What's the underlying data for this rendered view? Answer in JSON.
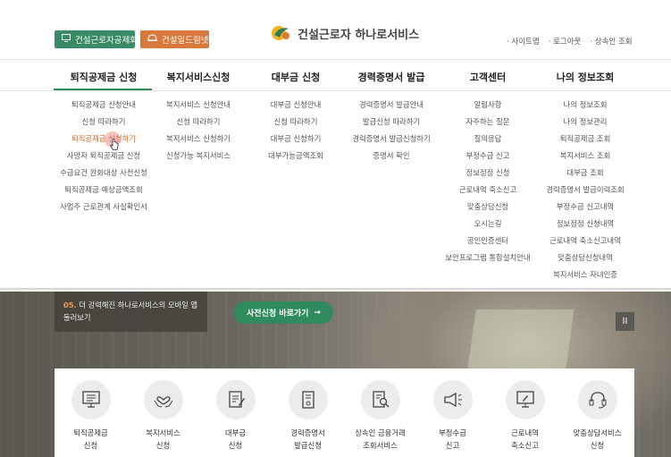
{
  "header": {
    "btn_mutual_aid": "건설근로자공제회",
    "btn_dream": "건설일드림넷",
    "logo_text": "건설근로자 하나로서비스",
    "util_links": [
      "사이트맵",
      "로그아웃",
      "상속인 조회"
    ]
  },
  "nav": {
    "tabs": [
      "퇴직공제금 신청",
      "복지서비스신청",
      "대부금 신청",
      "경력증명서 발급",
      "고객센터",
      "나의 정보조회"
    ],
    "active_index": 0
  },
  "dropdown": {
    "columns": [
      [
        "퇴직공제금 신청안내",
        "신청 따라하기",
        "퇴직공제금 신청하기",
        "사망자 퇴직공제금 신청",
        "수급요건 완화대상 사전신청",
        "퇴직공제금 예상금액조회",
        "사업주 근로관계 사실확인서"
      ],
      [
        "복지서비스 신청안내",
        "신청 따라하기",
        "복지서비스 신청하기",
        "신청가능 복지서비스"
      ],
      [
        "대부금 신청안내",
        "신청 따라하기",
        "대부금 신청하기",
        "대부가능금액조회"
      ],
      [
        "경력증명서 발급안내",
        "발급신청 따라하기",
        "경력증명서 발급신청하기",
        "증명서 확인"
      ],
      [
        "알림사항",
        "자주하는 질문",
        "질의응답",
        "부정수급 신고",
        "정보정정 신청",
        "근로내역 축소신고",
        "맞춤상담신청",
        "오시는길",
        "공인인증센터",
        "보안프로그램 통합설치안내"
      ],
      [
        "나의 정보조회",
        "나의 정보관리",
        "퇴직공제금 조회",
        "복지서비스 조회",
        "대부금 조회",
        "경력증명서 발급이력조회",
        "부정수급 신고내역",
        "정보정정 신청내역",
        "근로내역 축소신고내역",
        "맞춤상담신청내역",
        "복지서비스 자녀인증"
      ]
    ],
    "highlighted": "퇴직공제금 신청하기"
  },
  "hero": {
    "notice_number": "05.",
    "notice_text": "더 강력해진 하나로서비스의 모바일 앱 둘러보기",
    "cta_label": "사전신청 바로가기",
    "cta_arrow": "→",
    "pause_label": "II"
  },
  "quick_menu": [
    {
      "label": "퇴직공제금\n신청",
      "icon": "monitor-icon"
    },
    {
      "label": "복지서비스\n신청",
      "icon": "heart-hands-icon"
    },
    {
      "label": "대부금\n신청",
      "icon": "document-pen-icon"
    },
    {
      "label": "경력증명서\n발급신청",
      "icon": "certificate-icon"
    },
    {
      "label": "상속인 금융거래\n조회서비스",
      "icon": "document-search-icon"
    },
    {
      "label": "부정수급\n신고",
      "icon": "megaphone-icon"
    },
    {
      "label": "근로내역\n축소신고",
      "icon": "monitor-pen-icon"
    },
    {
      "label": "맞춤상담서비스\n신청",
      "icon": "headset-icon"
    }
  ],
  "colors": {
    "green": "#2f8a5e",
    "orange": "#d8682a",
    "header_green_btn": "#3a8a66",
    "header_orange_btn": "#d9783a"
  }
}
